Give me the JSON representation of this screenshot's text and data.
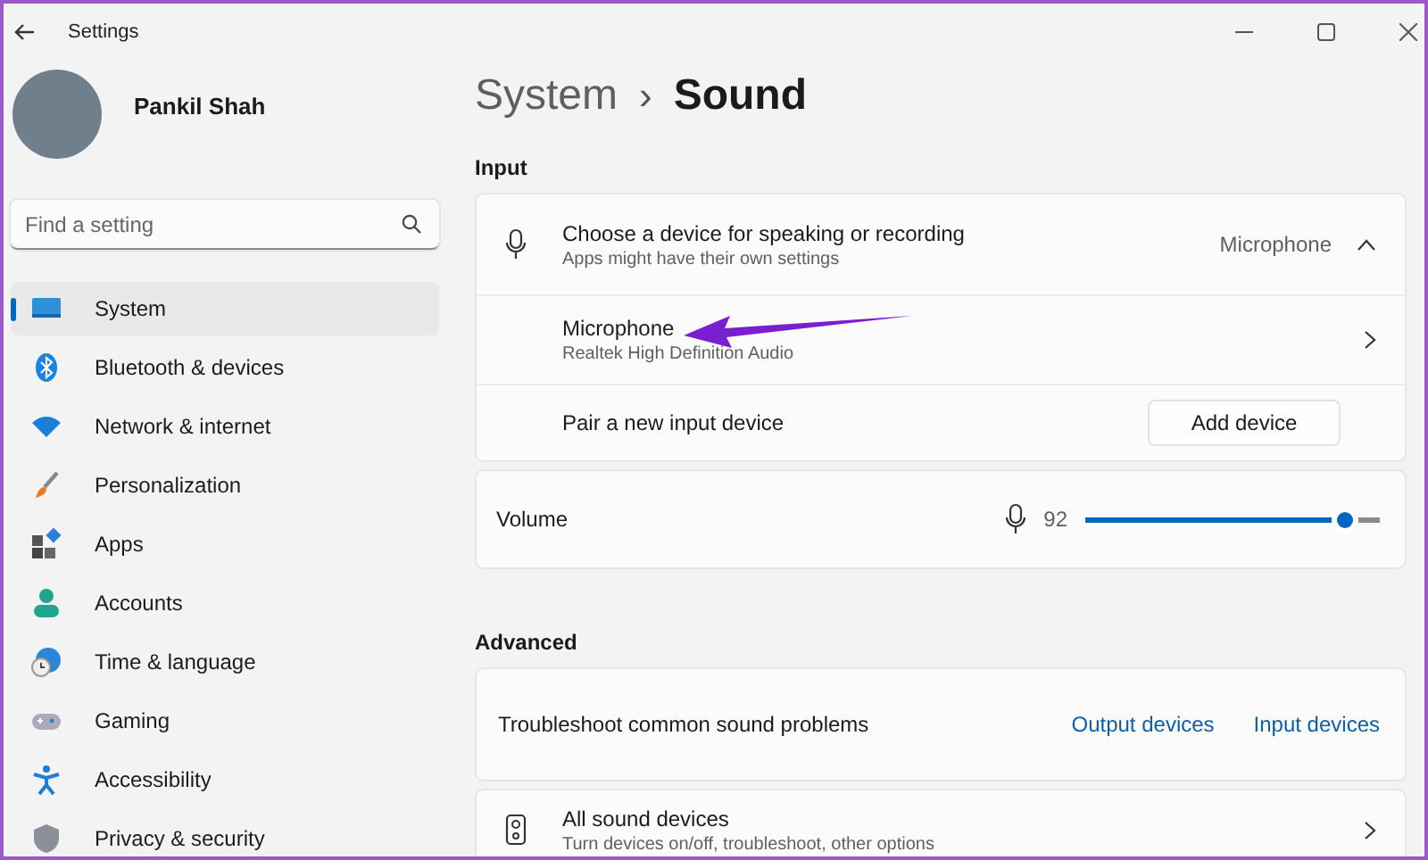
{
  "window": {
    "title": "Settings"
  },
  "user": {
    "name": "Pankil Shah"
  },
  "search": {
    "placeholder": "Find a setting"
  },
  "sidebar": {
    "items": [
      {
        "label": "System",
        "selected": true
      },
      {
        "label": "Bluetooth & devices",
        "selected": false
      },
      {
        "label": "Network & internet",
        "selected": false
      },
      {
        "label": "Personalization",
        "selected": false
      },
      {
        "label": "Apps",
        "selected": false
      },
      {
        "label": "Accounts",
        "selected": false
      },
      {
        "label": "Time & language",
        "selected": false
      },
      {
        "label": "Gaming",
        "selected": false
      },
      {
        "label": "Accessibility",
        "selected": false
      },
      {
        "label": "Privacy & security",
        "selected": false
      }
    ]
  },
  "breadcrumb": {
    "parent": "System",
    "separator": "›",
    "current": "Sound"
  },
  "input": {
    "heading": "Input",
    "device_chooser": {
      "title": "Choose a device for speaking or recording",
      "subtitle": "Apps might have their own settings",
      "value": "Microphone",
      "expanded": true
    },
    "devices": [
      {
        "name": "Microphone",
        "detail": "Realtek High Definition Audio"
      }
    ],
    "pair": {
      "label": "Pair a new input device",
      "button": "Add device"
    },
    "volume": {
      "label": "Volume",
      "reading": "92",
      "level": 0.92
    }
  },
  "advanced": {
    "heading": "Advanced",
    "troubleshoot": {
      "label": "Troubleshoot common sound problems",
      "links": [
        "Output devices",
        "Input devices"
      ]
    },
    "all_devices": {
      "title": "All sound devices",
      "subtitle": "Turn devices on/off, troubleshoot, other options"
    }
  }
}
